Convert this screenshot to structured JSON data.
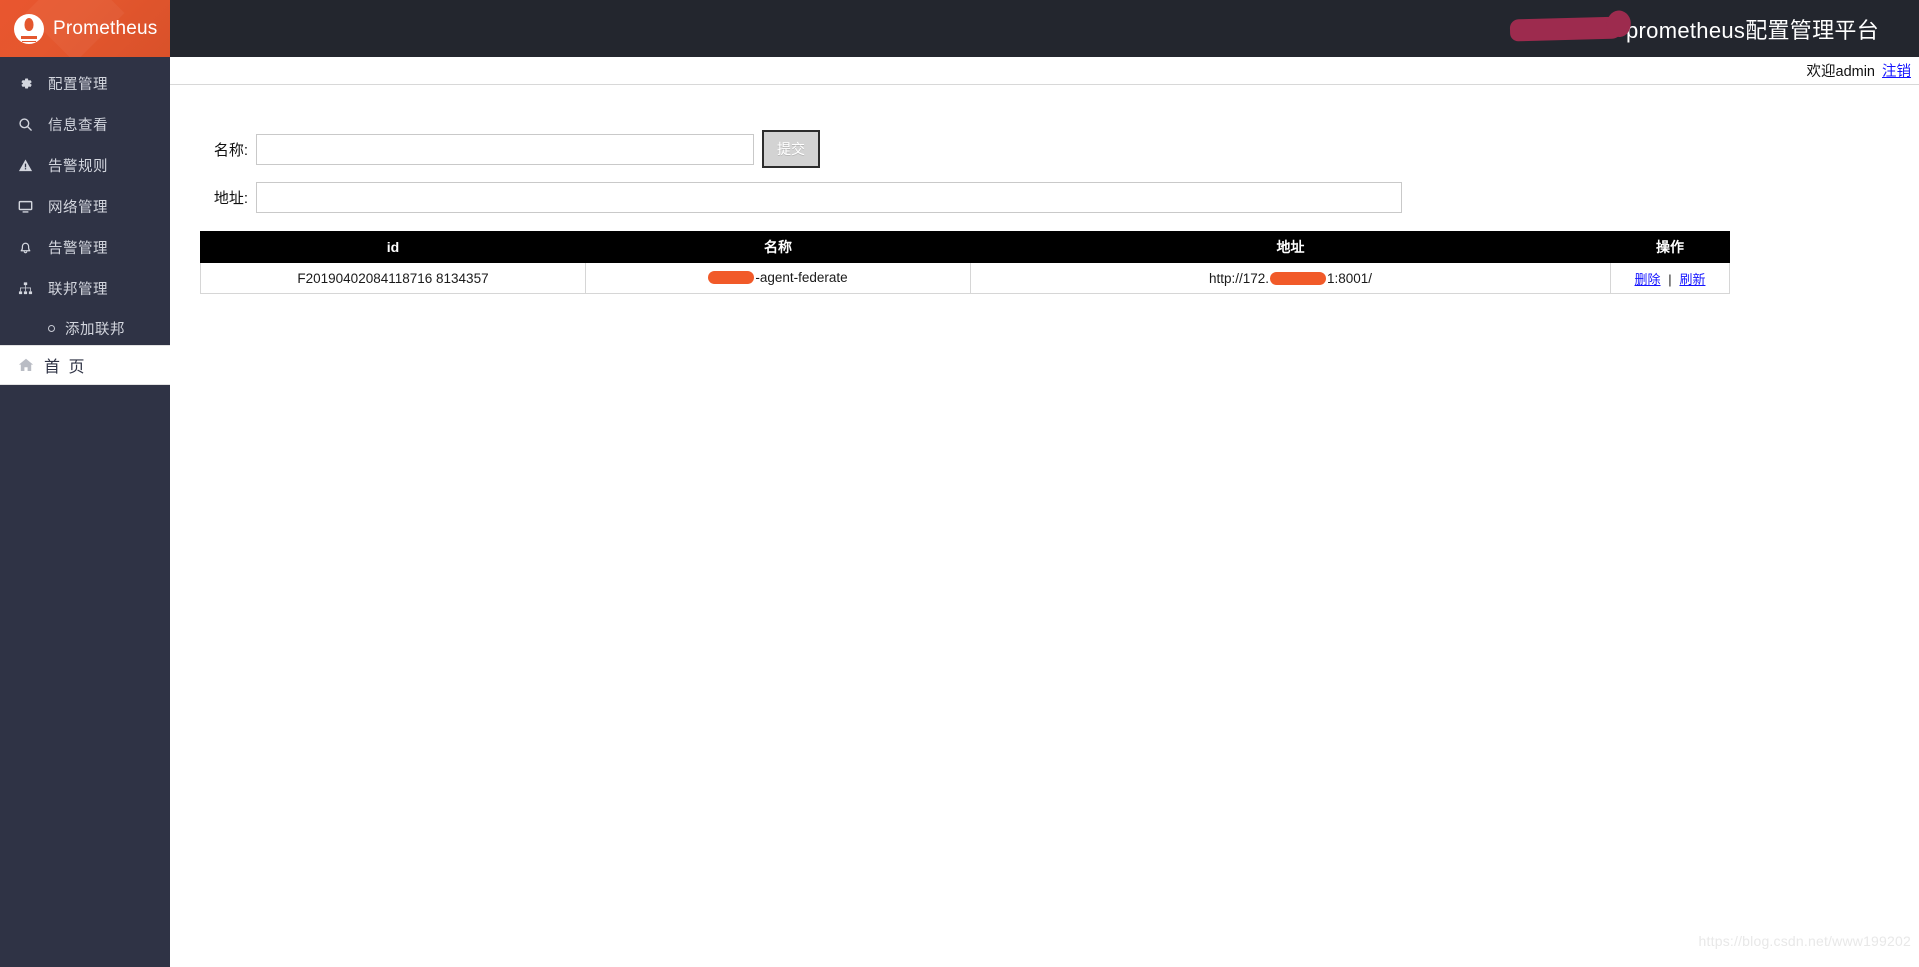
{
  "brand": {
    "name": "Prometheus",
    "logo_icon": "prometheus-torch-icon"
  },
  "topbar": {
    "title": "prometheus配置管理平台",
    "redaction": "redacted-logo-block"
  },
  "welcome": {
    "greeting": "欢迎admin",
    "logout_label": "注销"
  },
  "sidebar": {
    "items": [
      {
        "label": "配置管理",
        "icon": "gear-icon"
      },
      {
        "label": "信息查看",
        "icon": "search-icon"
      },
      {
        "label": "告警规则",
        "icon": "warning-triangle-icon"
      },
      {
        "label": "网络管理",
        "icon": "monitor-icon"
      },
      {
        "label": "告警管理",
        "icon": "bell-icon"
      },
      {
        "label": "联邦管理",
        "icon": "sitemap-icon"
      }
    ],
    "subitems": [
      {
        "label": "添加联邦",
        "icon": "circle-bullet-icon"
      }
    ],
    "home": {
      "label": "首 页",
      "icon": "home-icon"
    }
  },
  "form": {
    "name_label": "名称:",
    "name_value": "",
    "name_placeholder": "",
    "addr_label": "地址:",
    "addr_value": "",
    "addr_placeholder": "",
    "submit_label": "提交"
  },
  "table": {
    "headers": [
      "id",
      "名称",
      "地址",
      "操作"
    ],
    "rows": [
      {
        "id": "F20190402084118716 8134357",
        "name_suffix": "-agent-federate",
        "addr_prefix": "http://172.",
        "addr_suffix": "1:8001/",
        "actions": {
          "delete_label": "删除",
          "separator": "|",
          "refresh_label": "刷新"
        }
      }
    ]
  },
  "watermark": {
    "text": "https://blog.csdn.net/www199202"
  },
  "colors": {
    "brand_orange": "#e4572e",
    "sidebar_bg": "#2f3345",
    "topbar_bg": "#23262e",
    "link_blue": "#1414ff",
    "table_header_bg": "#000000",
    "redaction_orange": "#f15a29",
    "redaction_maroon": "#9d2b4e"
  }
}
